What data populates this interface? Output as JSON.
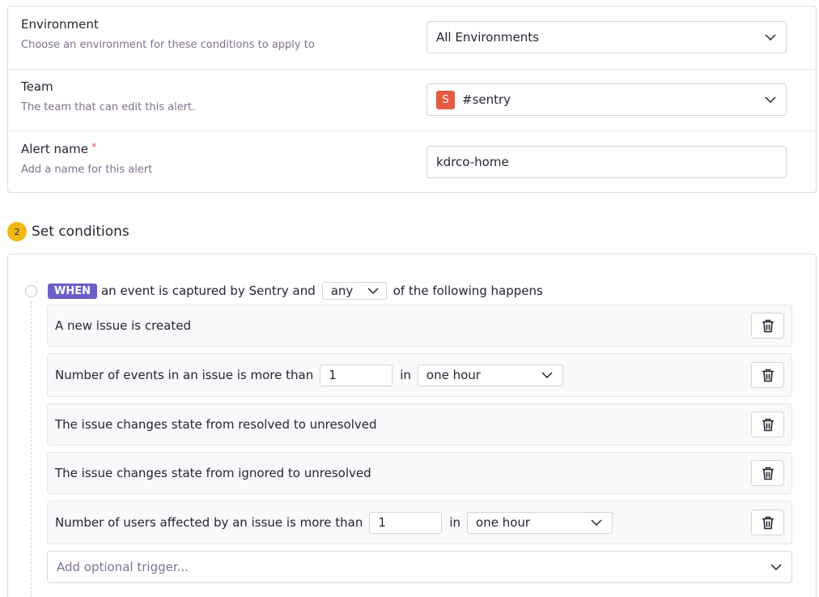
{
  "settings": {
    "environment": {
      "label": "Environment",
      "help": "Choose an environment for these conditions to apply to",
      "value": "All Environments"
    },
    "team": {
      "label": "Team",
      "help": "The team that can edit this alert.",
      "avatar_letter": "S",
      "avatar_color": "#e35a41",
      "value": "#sentry"
    },
    "alert_name": {
      "label": "Alert name",
      "required_mark": "*",
      "help": "Add a name for this alert",
      "value": "kdrco-home"
    }
  },
  "conditions_section": {
    "step_number": "2",
    "title": "Set conditions",
    "when_tag": "WHEN",
    "when_prefix": "an event is captured by Sentry and",
    "match": "any",
    "when_suffix": "of the following happens",
    "conditions": [
      {
        "text": "A new issue is created"
      },
      {
        "text": "Number of events in an issue is more than",
        "value": "1",
        "in_word": "in",
        "interval": "one hour"
      },
      {
        "text": "The issue changes state from resolved to unresolved"
      },
      {
        "text": "The issue changes state from ignored to unresolved"
      },
      {
        "text": "Number of users affected by an issue is more than",
        "value": "1",
        "in_word": "in",
        "interval": "one hour"
      }
    ],
    "add_trigger_placeholder": "Add optional trigger..."
  },
  "colors": {
    "accent": "#6c5fc7",
    "step_badge": "#f2b712",
    "required": "#e0596b"
  },
  "icons": [
    "chevron-down-icon",
    "trash-icon",
    "timeline-dot-icon"
  ]
}
